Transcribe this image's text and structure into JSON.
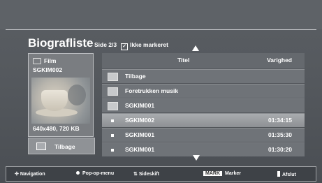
{
  "header": {
    "title": "Biografliste",
    "page": "Side 2/3",
    "marked": "Ikke markeret"
  },
  "preview": {
    "category": "Film",
    "filename": "SGKIM002",
    "resolution": "640x480, 720 KB"
  },
  "back_button": {
    "label": "Tilbage"
  },
  "list": {
    "col_title": "Titel",
    "col_duration": "Varighed",
    "rows": [
      {
        "type": "back",
        "name": "Tilbage",
        "duration": ""
      },
      {
        "type": "folder",
        "name": "Foretrukken musik",
        "duration": ""
      },
      {
        "type": "folder",
        "name": "SGKIM001",
        "duration": ""
      },
      {
        "type": "file",
        "name": "SGKIM002",
        "duration": "01:34:15",
        "selected": true
      },
      {
        "type": "file",
        "name": "SGKIM001",
        "duration": "01:35:30"
      },
      {
        "type": "file",
        "name": "SGKIM001",
        "duration": "01:30:20"
      }
    ]
  },
  "footer": {
    "navigation": "Navigation",
    "popup": "Pop-op-menu",
    "pageshift": "Sideskift",
    "mark_key": "MARK",
    "mark": "Marker",
    "exit": "Afslut"
  },
  "colors": {
    "selected_row": "#9c9fa3",
    "row": "#6f7378",
    "background": "#55595e"
  }
}
